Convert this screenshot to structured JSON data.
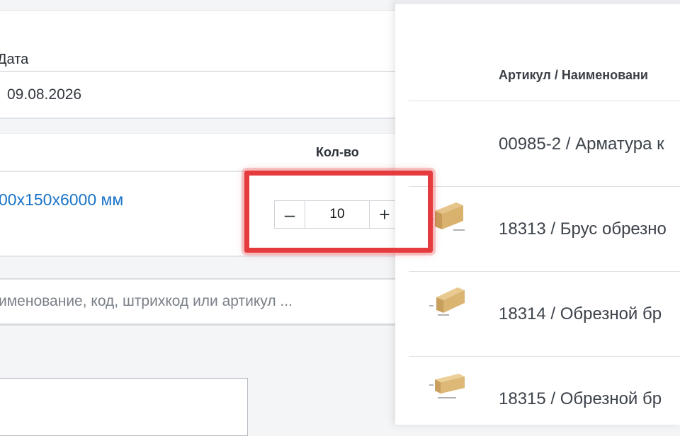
{
  "form": {
    "date_label": "Дата",
    "date_value": "09.08.2026"
  },
  "table": {
    "qty_header": "Кол-во",
    "row": {
      "product_name": "00x150x6000 мм",
      "quantity": "10",
      "minus_label": "–",
      "plus_label": "+"
    }
  },
  "search": {
    "placeholder": "именование, код, штрихкод или артикул ..."
  },
  "catalog": {
    "column_header": "Артикул / Наименовани",
    "items": [
      {
        "label": "00985-2 / Арматура к",
        "thumbnail": "none"
      },
      {
        "label": "18313 / Брус обрезно",
        "thumbnail": "timber-beam-icon"
      },
      {
        "label": "18314 / Обрезной бр",
        "thumbnail": "timber-beam-icon"
      },
      {
        "label": "18315 / Обрезной бр",
        "thumbnail": "timber-beam-icon"
      }
    ]
  },
  "colors": {
    "link": "#1a73c7",
    "highlight": "#e53a3e"
  }
}
